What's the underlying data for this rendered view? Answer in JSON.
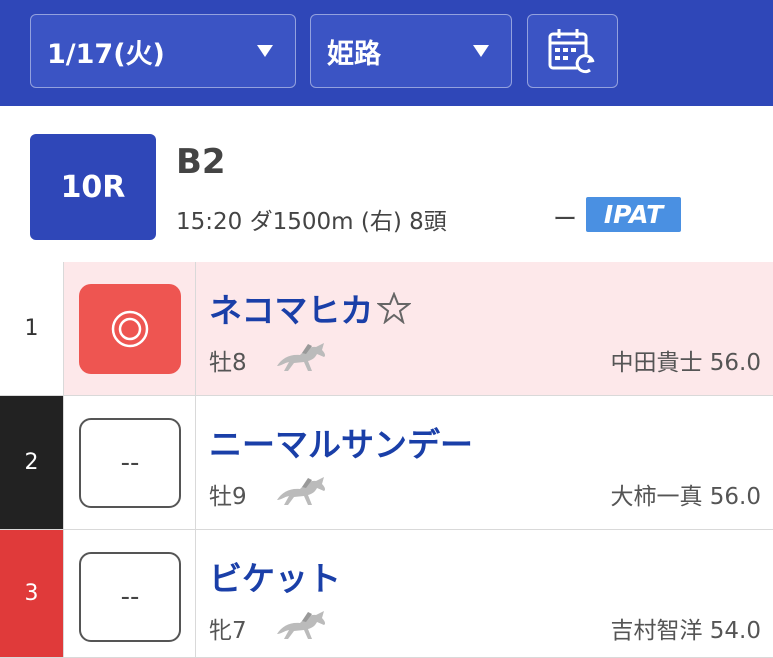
{
  "header": {
    "date_select": "1/17(火)",
    "venue_select": "姫路",
    "calendar_icon": "calendar-refresh-icon"
  },
  "race": {
    "number": "10R",
    "class": "B2",
    "info": "15:20 ダ1500m (右) 8頭",
    "status": "ー",
    "ipat_badge": "IPAT"
  },
  "entries": [
    {
      "number": "1",
      "mark": "",
      "mark_icon": "double-circle-icon",
      "name": "ネコマヒカ",
      "favorite_icon": "star-outline-icon",
      "sex_age": "牡8",
      "jockey": "中田貴士 56.0"
    },
    {
      "number": "2",
      "mark": "--",
      "name": "ニーマルサンデー",
      "sex_age": "牡9",
      "jockey": "大柿一真 56.0"
    },
    {
      "number": "3",
      "mark": "--",
      "name": "ビケット",
      "sex_age": "牝7",
      "jockey": "吉村智洋 54.0"
    }
  ],
  "colors": {
    "header_bg": "#2f47b8",
    "highlight_row": "#fde8ea",
    "mark_red": "#ee5551",
    "ipat_blue": "#4a90e2",
    "frame_1": "#ffffff",
    "frame_2": "#222222",
    "frame_3": "#e03a3a"
  }
}
